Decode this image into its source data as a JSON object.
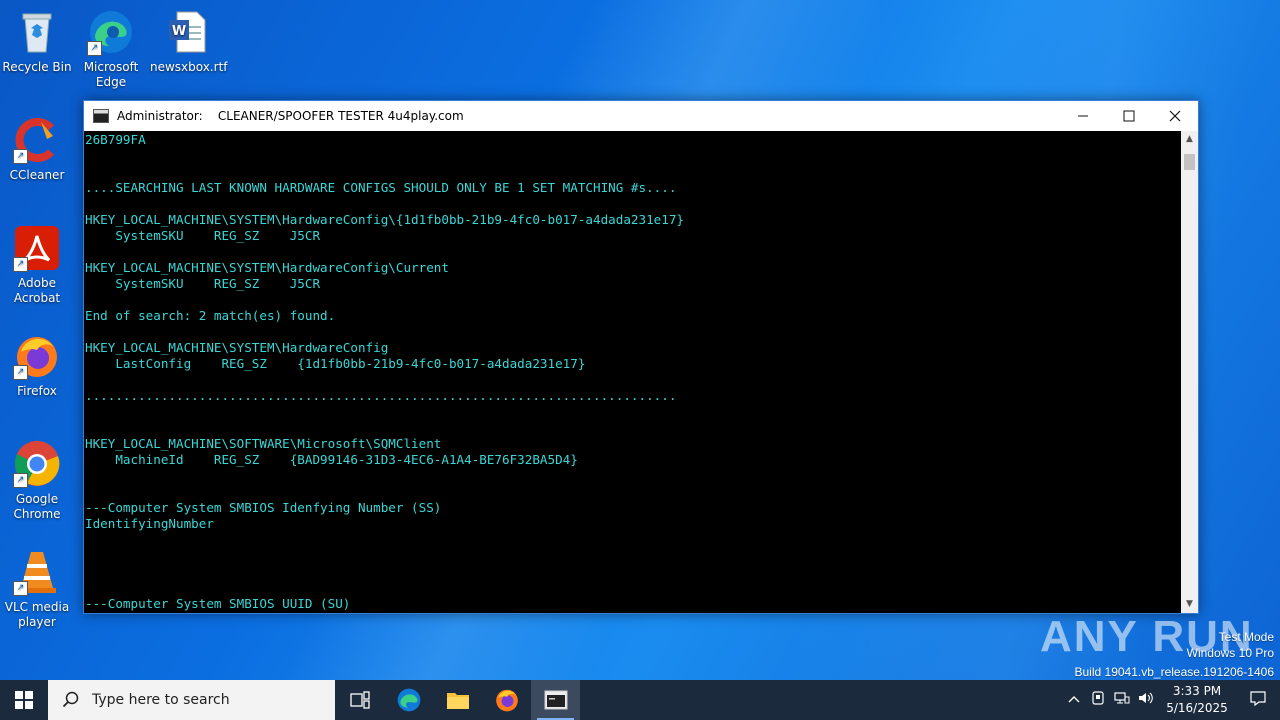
{
  "desktop": {
    "icons": [
      {
        "label": "Recycle Bin"
      },
      {
        "label": "Microsoft Edge"
      },
      {
        "label": "newsxbox.rtf"
      },
      {
        "label": "CCleaner"
      },
      {
        "label": "Adobe Acrobat"
      },
      {
        "label": "Firefox"
      },
      {
        "label": "Google Chrome"
      },
      {
        "label": "VLC media player"
      }
    ]
  },
  "window": {
    "title": "Administrator:    CLEANER/SPOOFER TESTER 4u4play.com",
    "lines": [
      "26B799FA",
      "",
      "",
      "....SEARCHING LAST KNOWN HARDWARE CONFIGS SHOULD ONLY BE 1 SET MATCHING #s....",
      "",
      "HKEY_LOCAL_MACHINE\\SYSTEM\\HardwareConfig\\{1d1fb0bb-21b9-4fc0-b017-a4dada231e17}",
      "    SystemSKU    REG_SZ    J5CR",
      "",
      "HKEY_LOCAL_MACHINE\\SYSTEM\\HardwareConfig\\Current",
      "    SystemSKU    REG_SZ    J5CR",
      "",
      "End of search: 2 match(es) found.",
      "",
      "HKEY_LOCAL_MACHINE\\SYSTEM\\HardwareConfig",
      "    LastConfig    REG_SZ    {1d1fb0bb-21b9-4fc0-b017-a4dada231e17}",
      "",
      "..............................................................................",
      "",
      "",
      "HKEY_LOCAL_MACHINE\\SOFTWARE\\Microsoft\\SQMClient",
      "    MachineId    REG_SZ    {BAD99146-31D3-4EC6-A1A4-BE76F32BA5D4}",
      "",
      "",
      "---Computer System SMBIOS Idenfying Number (SS)",
      "IdentifyingNumber",
      "",
      "",
      "",
      "",
      "---Computer System SMBIOS UUID (SU)"
    ],
    "text_color": "#3bd6d6"
  },
  "watermark": {
    "brand": "ANY RUN",
    "line1": "Test Mode",
    "line2": "Windows 10 Pro",
    "line3": "Build 19041.vb_release.191206-1406"
  },
  "taskbar": {
    "search_placeholder": "Type here to search",
    "time": "3:33 PM",
    "date": "5/16/2025"
  }
}
